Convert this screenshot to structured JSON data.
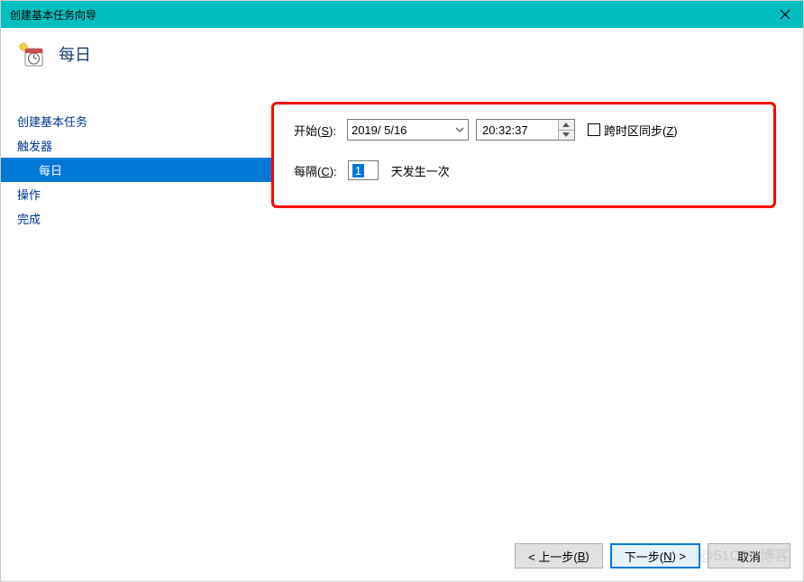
{
  "titlebar": {
    "text": "创建基本任务向导"
  },
  "header": {
    "title": "每日"
  },
  "sidebar": {
    "items": [
      {
        "label": "创建基本任务",
        "selected": false,
        "indent": false
      },
      {
        "label": "触发器",
        "selected": false,
        "indent": false
      },
      {
        "label": "每日",
        "selected": true,
        "indent": true
      },
      {
        "label": "操作",
        "selected": false,
        "indent": false
      },
      {
        "label": "完成",
        "selected": false,
        "indent": false
      }
    ]
  },
  "form": {
    "start_label_prefix": "开始(",
    "start_label_key": "S",
    "start_label_suffix": "):",
    "date_value": "2019/ 5/16",
    "time_value": "20:32:37",
    "sync_label_prefix": "跨时区同步(",
    "sync_label_key": "Z",
    "sync_label_suffix": ")",
    "interval_label_prefix": "每隔(",
    "interval_label_key": "C",
    "interval_label_suffix": "):",
    "interval_value": "1",
    "interval_suffix": "天发生一次"
  },
  "buttons": {
    "back_prefix": "< 上一步(",
    "back_key": "B",
    "back_suffix": ")",
    "next_prefix": "下一步(",
    "next_key": "N",
    "next_suffix": ") >",
    "cancel": "取消"
  },
  "watermark": "@51CTO博客"
}
